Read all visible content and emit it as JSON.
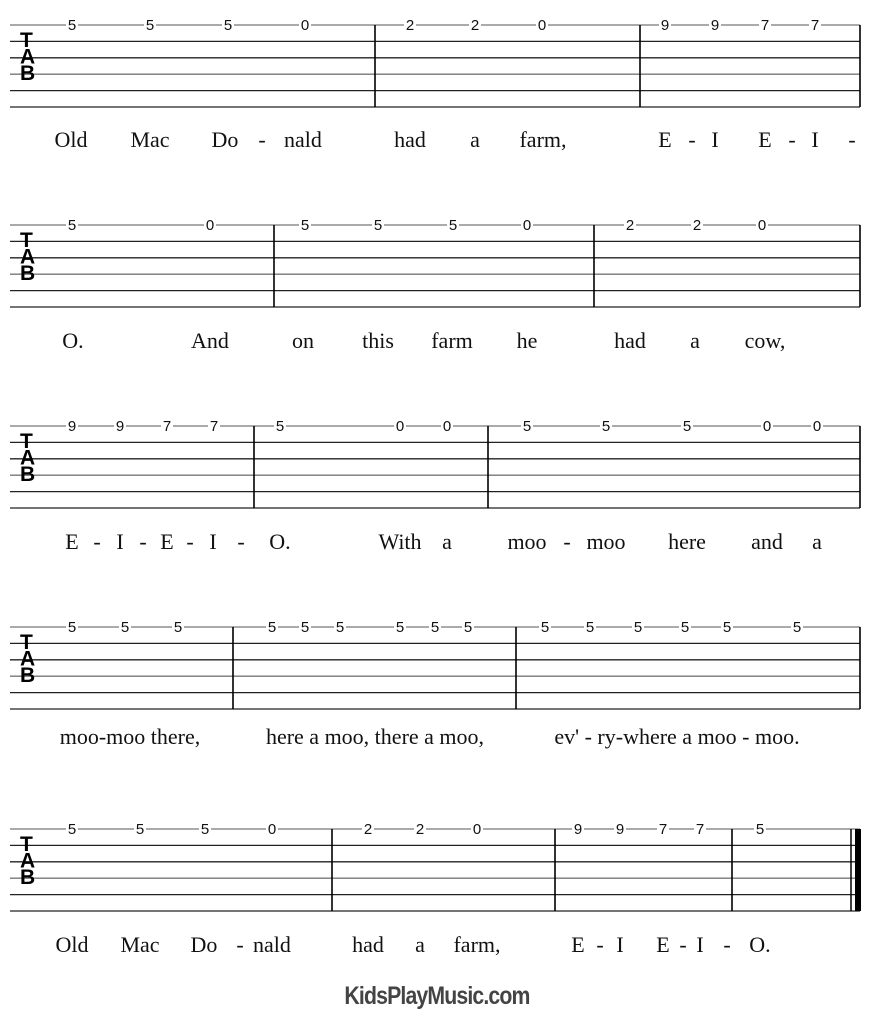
{
  "clef_label": [
    "T",
    "A",
    "B"
  ],
  "systems": [
    {
      "measures": [
        [
          "5",
          "5",
          "5",
          "0"
        ],
        [
          "2",
          "2",
          "0"
        ],
        [
          "9",
          "9",
          "7",
          "7"
        ]
      ],
      "lyrics": [
        "Old",
        "Mac",
        "Do",
        "-",
        "nald",
        "had",
        "a",
        "farm,",
        "E",
        "-",
        "I",
        "E",
        "-",
        "I",
        "-"
      ]
    },
    {
      "measures": [
        [
          "5",
          "0"
        ],
        [
          "5",
          "5",
          "5",
          "0"
        ],
        [
          "2",
          "2",
          "0"
        ]
      ],
      "lyrics": [
        "O.",
        "And",
        "on",
        "this",
        "farm",
        "he",
        "had",
        "a",
        "cow,"
      ]
    },
    {
      "measures": [
        [
          "9",
          "9",
          "7",
          "7"
        ],
        [
          "5",
          "0",
          "0"
        ],
        [
          "5",
          "5",
          "5",
          "0",
          "0"
        ]
      ],
      "lyrics": [
        "E",
        "-",
        "I",
        "-",
        "E",
        "-",
        "I",
        "-",
        "O.",
        "With",
        "a",
        "moo",
        "-",
        "moo",
        "here",
        "and",
        "a"
      ]
    },
    {
      "measures": [
        [
          "5",
          "5",
          "5"
        ],
        [
          "5",
          "5",
          "5",
          "5",
          "5",
          "5"
        ],
        [
          "5",
          "5",
          "5",
          "5",
          "5",
          "5"
        ]
      ],
      "lyrics": [
        "moo-moo there,",
        "here a moo, there a moo,",
        "ev' - ry-where a  moo - moo."
      ]
    },
    {
      "measures": [
        [
          "5",
          "5",
          "5",
          "0"
        ],
        [
          "2",
          "2",
          "0"
        ],
        [
          "9",
          "9",
          "7",
          "7"
        ],
        [
          "5"
        ]
      ],
      "lyrics": [
        "Old",
        "Mac",
        "Do",
        "-",
        "nald",
        "had",
        "a",
        "farm,",
        "E",
        "-",
        "I",
        "E",
        "-",
        "I",
        "-",
        "O."
      ],
      "final_barline": true
    }
  ],
  "footer": "KidsPlayMusic.com"
}
